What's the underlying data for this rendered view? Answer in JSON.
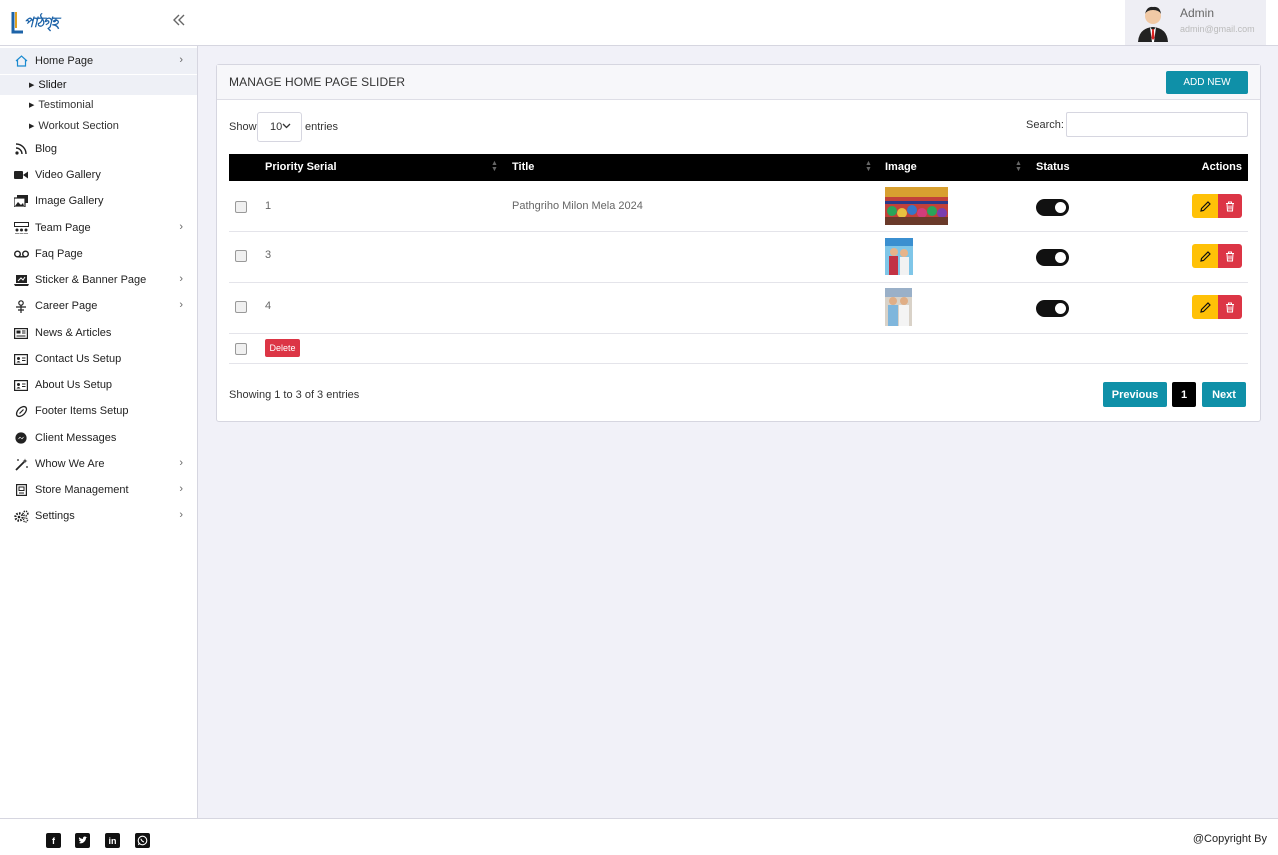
{
  "brand": {
    "logo_text": "পাঠগৃহ"
  },
  "user": {
    "name": "Admin",
    "email": "admin@gmail.com"
  },
  "sidebar": {
    "items": [
      {
        "label": "Home Page"
      },
      {
        "label": "Blog"
      },
      {
        "label": "Video Gallery"
      },
      {
        "label": "Image Gallery"
      },
      {
        "label": "Team Page"
      },
      {
        "label": "Faq Page"
      },
      {
        "label": "Sticker & Banner Page"
      },
      {
        "label": "Career Page"
      },
      {
        "label": "News & Articles"
      },
      {
        "label": "Contact Us Setup"
      },
      {
        "label": "About Us Setup"
      },
      {
        "label": "Footer Items Setup"
      },
      {
        "label": "Client Messages"
      },
      {
        "label": "Whow We Are"
      },
      {
        "label": "Store Management"
      },
      {
        "label": "Settings"
      }
    ],
    "home_sub": [
      {
        "label": "Slider"
      },
      {
        "label": "Testimonial"
      },
      {
        "label": "Workout Section"
      }
    ]
  },
  "main": {
    "title": "MANAGE HOME PAGE SLIDER",
    "add_label": "ADD NEW",
    "show_label": "Show",
    "page_length": "10",
    "entries_label": "entries",
    "search_label": "Search:",
    "search_value": "",
    "columns": [
      "Priority Serial",
      "Title",
      "Image",
      "Status",
      "Actions"
    ],
    "rows": [
      {
        "serial": "1",
        "title": "Pathgriho Milon Mela 2024",
        "status": "on"
      },
      {
        "serial": "3",
        "title": "",
        "status": "on"
      },
      {
        "serial": "4",
        "title": "",
        "status": "on"
      }
    ],
    "bulk_delete_label": "Delete",
    "info": "Showing 1 to 3 of 3 entries",
    "pagination": {
      "prev": "Previous",
      "current": "1",
      "next": "Next"
    }
  },
  "footer": {
    "social": [
      "facebook-icon",
      "twitter-icon",
      "linkedin-icon",
      "whatsapp-icon"
    ],
    "copyright": "@Copyright By"
  },
  "colors": {
    "accent": "#0f90a8",
    "danger": "#dc3545",
    "warning": "#ffc107",
    "header_bg": "#000000"
  }
}
